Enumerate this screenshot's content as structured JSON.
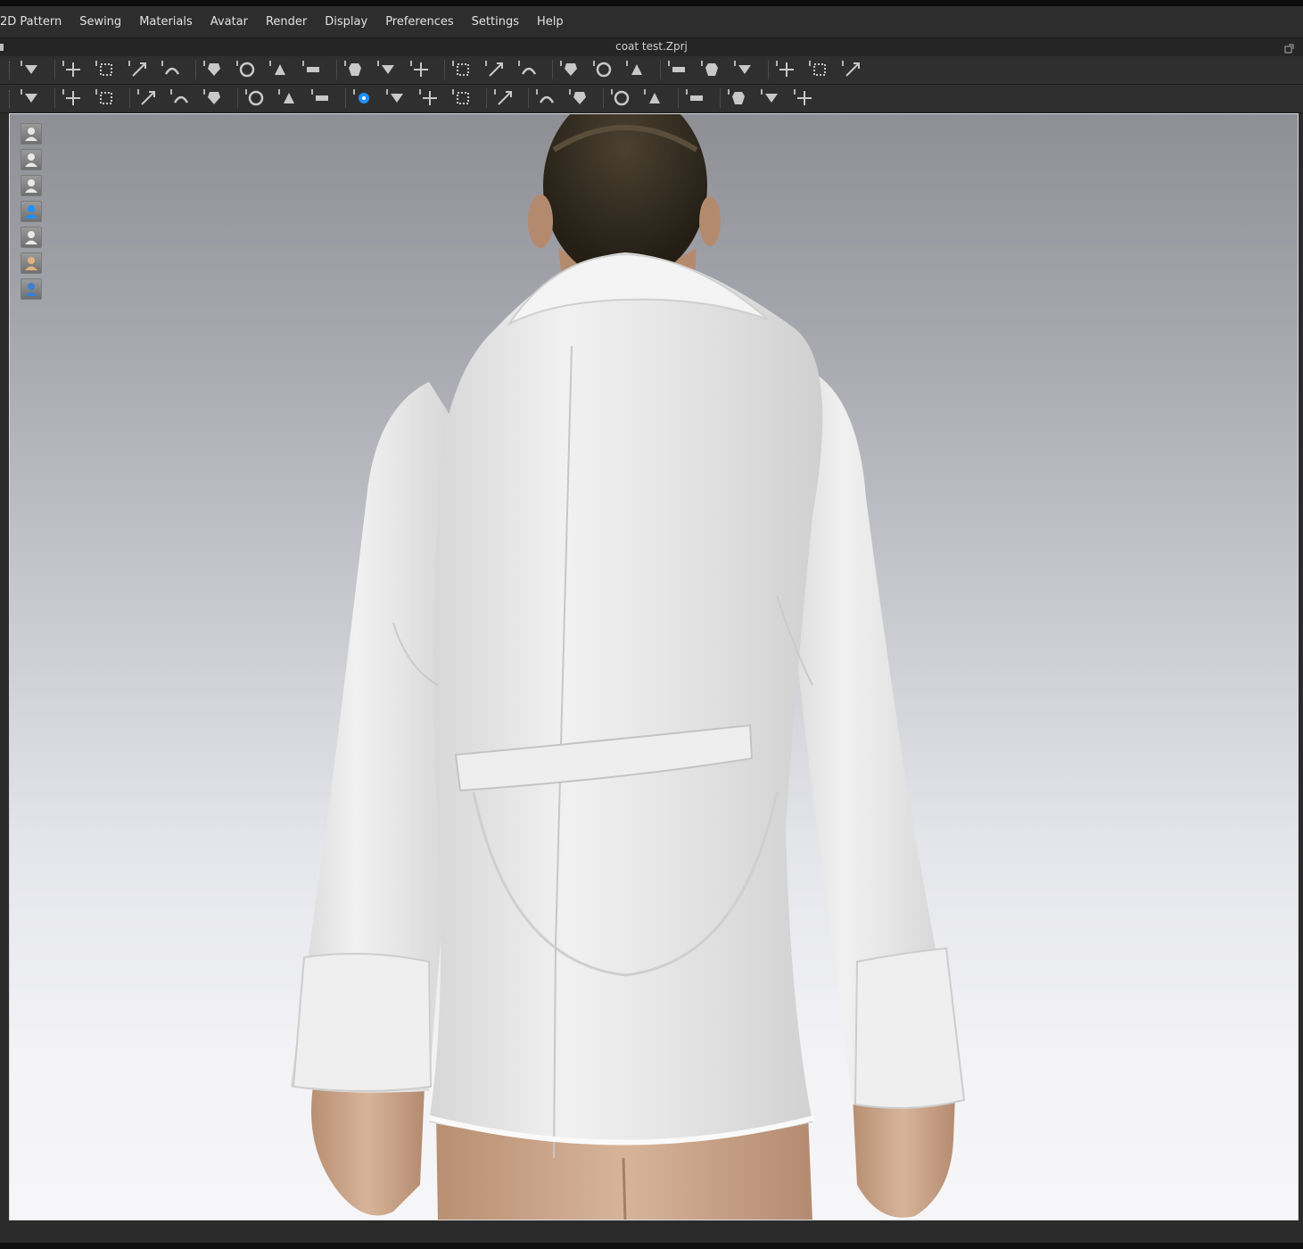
{
  "menu": {
    "items": [
      "2D Pattern",
      "Sewing",
      "Materials",
      "Avatar",
      "Render",
      "Display",
      "Preferences",
      "Settings",
      "Help"
    ]
  },
  "window": {
    "title": "coat test.Zprj"
  },
  "toolbar1": {
    "icons": [
      "down-arrow-icon",
      "select-move-icon",
      "transform-box-icon",
      "resize-box-icon",
      "fold-tool-icon",
      "tack-tool-icon",
      "rotate-tool-icon",
      "loop-tool-icon",
      "edit-curve-icon",
      "arrangement-icon",
      "garment-icon",
      "shirt-up-icon",
      "avatar-body-icon",
      "shirt-plain-icon",
      "fit-up-icon",
      "fit-down-icon",
      "arrow-recycle-icon",
      "layer-stack-icon",
      "layer-flat-icon",
      "pin-tool-icon",
      "pin-multi-icon",
      "tape-measure-icon",
      "ring-measure-icon",
      "ruler-icon"
    ]
  },
  "toolbar2": {
    "icons": [
      "walk-pose-icon",
      "pose-bend-icon",
      "pose-fold-icon",
      "pose-curve-icon",
      "pose-x-icon",
      "fold-block-icon",
      "button-add-icon",
      "button-multi-icon",
      "buttonhole-icon",
      "button-blue-icon",
      "button-round-icon",
      "line-tool-icon",
      "lock-button-icon",
      "zipper-icon",
      "texture-edit-icon",
      "texture-block-icon",
      "graphic-edit-icon",
      "graphic-block-icon",
      "align-center-icon",
      "shirt-arrange-icon",
      "shirt-dark-icon",
      "shirt-rotate-icon"
    ]
  },
  "sidebar": {
    "icons": [
      "show-garment-icon",
      "show-pattern-icon",
      "show-avatar-icon",
      "show-material-icon",
      "show-shader-icon",
      "show-skin-icon",
      "show-globe-icon"
    ]
  },
  "colors": {
    "accent": "#1e90ff",
    "menubar": "#2d2d2d",
    "toolbar": "#2f2f2f",
    "viewport_top": "#8e8f95",
    "viewport_bottom": "#f6f6f8",
    "garment": "#e7e7e7",
    "skin": "#c9a489",
    "hair": "#3b3326"
  }
}
